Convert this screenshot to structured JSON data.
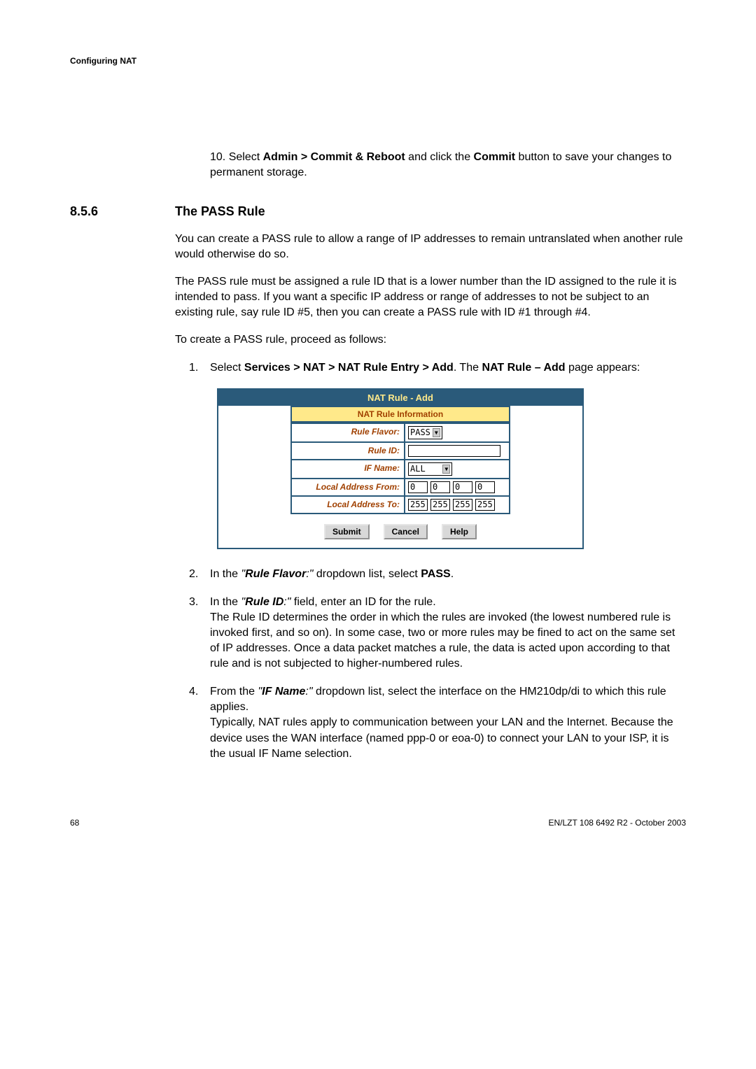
{
  "header": "Configuring NAT",
  "step10_prefix": "10. Select ",
  "step10_b1": "Admin > Commit & Reboot",
  "step10_mid": " and click the ",
  "step10_b2": "Commit",
  "step10_suffix": " button to save your changes to permanent storage.",
  "section_num": "8.5.6",
  "section_title": "The PASS Rule",
  "para1": "You can create a PASS rule to allow a range of IP addresses to remain untranslated when another rule would otherwise do so.",
  "para2": "The PASS rule must be assigned a rule ID that is a lower number than the ID assigned to the rule it is intended to pass. If you want a specific IP address or range of addresses to not be subject to an existing rule, say rule ID #5, then you can create a PASS rule with ID #1 through #4.",
  "para3": "To create a PASS rule, proceed as follows:",
  "item1_num": "1.",
  "item1_a": "Select ",
  "item1_b": "Services > NAT > NAT Rule Entry > Add",
  "item1_c": ". The ",
  "item1_d": "NAT Rule – Add",
  "item1_e": " page appears:",
  "dialog": {
    "title": "NAT Rule - Add",
    "subtitle": "NAT Rule Information",
    "rows": {
      "flavor_label": "Rule Flavor:",
      "flavor_value": "PASS",
      "id_label": "Rule ID:",
      "id_value": "",
      "if_label": "IF Name:",
      "if_value": "ALL",
      "from_label": "Local Address From:",
      "from_oct": [
        "0",
        "0",
        "0",
        "0"
      ],
      "to_label": "Local Address To:",
      "to_oct": [
        "255",
        "255",
        "255",
        "255"
      ]
    },
    "buttons": {
      "submit": "Submit",
      "cancel": "Cancel",
      "help": "Help"
    }
  },
  "item2_num": "2.",
  "item2_a": "In the ",
  "item2_b": "\"Rule Flavor:\"",
  "item2_c": " dropdown list, select ",
  "item2_d": "PASS",
  "item2_e": ".",
  "item3_num": "3.",
  "item3_a": "In the ",
  "item3_b": "\"Rule ID:\"",
  "item3_c": " field, enter an ID for the rule.",
  "item3_d": "The Rule ID determines the order in which the rules are invoked (the lowest numbered rule is invoked first, and so on). In some case, two or more rules may be fined to act on the same set of IP addresses. Once a data packet matches a rule, the data is acted upon according to that rule and is not subjected to higher-numbered rules.",
  "item4_num": "4.",
  "item4_a": "From the ",
  "item4_b": "\"IF Name:\"",
  "item4_c": " dropdown list, select the interface on the HM210dp/di to which this rule applies.",
  "item4_d": "Typically, NAT rules apply to communication between your LAN and the Internet. Because the device uses the WAN interface (named ppp-0 or eoa-0) to connect your LAN to your ISP, it is the usual IF Name selection.",
  "footer_page": "68",
  "footer_right": "EN/LZT 108 6492 R2  -  October 2003"
}
